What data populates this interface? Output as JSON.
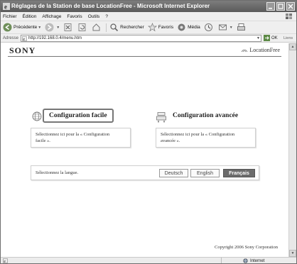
{
  "window": {
    "title": "Réglages de la Station de base LocationFree - Microsoft Internet Explorer"
  },
  "menu": [
    "Fichier",
    "Édition",
    "Affichage",
    "Favoris",
    "Outils",
    "?"
  ],
  "toolbar": {
    "back": "Précédente",
    "search": "Rechercher",
    "favorites": "Favoris",
    "media": "Média"
  },
  "address": {
    "label": "Adresse",
    "url": "http://192.168.0.4/menu.htm",
    "go": "OK",
    "links": "Liens"
  },
  "page": {
    "logo": "SONY",
    "brand": "LocationFree",
    "easy": {
      "title": "Configuration facile",
      "desc_line1": "Sélectionnez ici pour la « Configuration",
      "desc_line2": "facile »."
    },
    "advanced": {
      "title": "Configuration avancée",
      "desc_line1": "Sélectionnez ici pour la « Configuration",
      "desc_line2": "avancée »."
    },
    "language": {
      "label": "Sélectionnez la langue.",
      "options": [
        "Deutsch",
        "English",
        "Français"
      ],
      "selected": "Français"
    },
    "copyright": "Copyright 2006 Sony Corporation"
  },
  "status": {
    "zone": "Internet"
  },
  "icons": {
    "back": "back-arrow-icon",
    "forward": "forward-arrow-icon",
    "stop": "stop-icon",
    "refresh": "refresh-icon",
    "home": "home-icon",
    "search": "search-icon",
    "favorites": "star-icon",
    "media": "media-icon",
    "history": "history-icon",
    "mail": "mail-icon",
    "print": "print-icon",
    "globe": "globe-icon",
    "router": "router-icon"
  }
}
